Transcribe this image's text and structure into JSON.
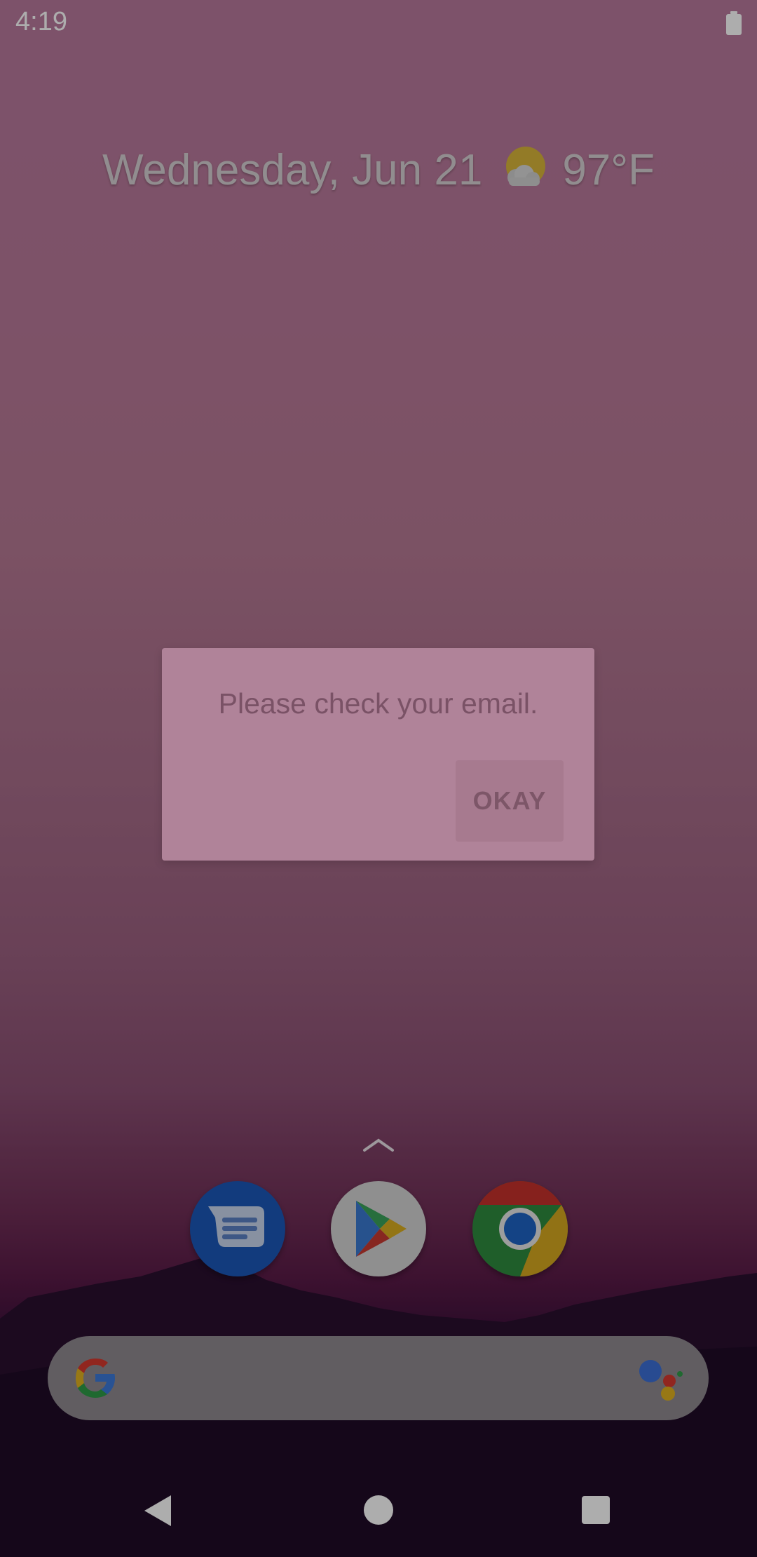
{
  "status_bar": {
    "time": "4:19",
    "battery_icon": "battery-full-icon"
  },
  "home_widget": {
    "date": "Wednesday, Jun 21",
    "weather_icon": "partly-cloudy-icon",
    "temperature": "97°F"
  },
  "dialog": {
    "message": "Please check your email.",
    "ok_label": "OKAY"
  },
  "dock": {
    "apps": [
      {
        "icon": "messages-icon"
      },
      {
        "icon": "play-store-icon"
      },
      {
        "icon": "chrome-icon"
      }
    ]
  },
  "search_bar": {
    "google_icon": "google-g-icon",
    "assistant_icon": "assistant-icon"
  },
  "nav_bar": {
    "back": "back-icon",
    "home": "home-icon",
    "recents": "recents-icon"
  }
}
